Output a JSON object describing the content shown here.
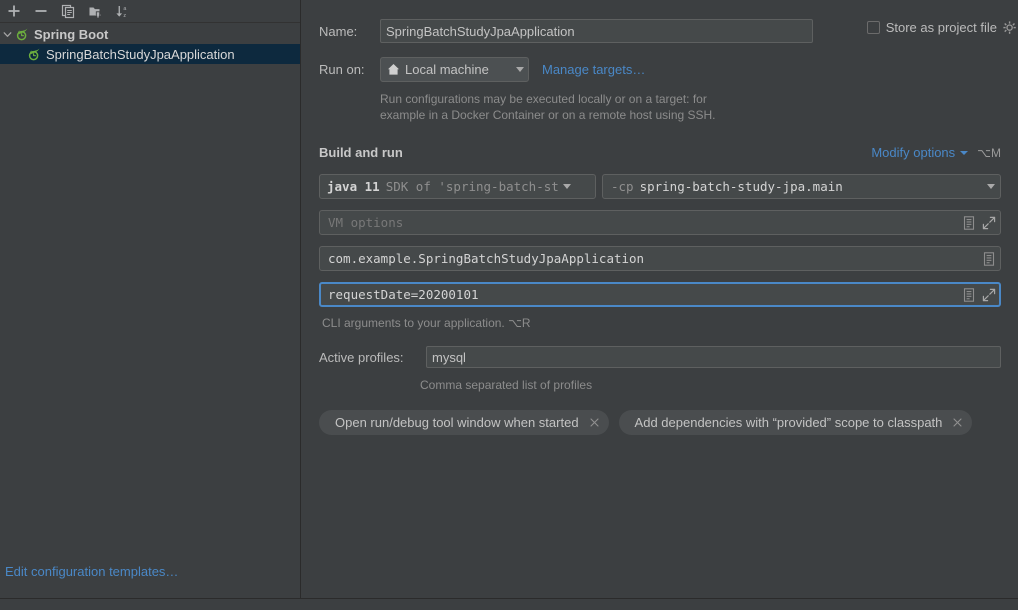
{
  "sidebar": {
    "toolbar": [
      {
        "name": "add-configuration-button",
        "icon": "plus-icon",
        "tooltip": "Add New Configuration"
      },
      {
        "name": "remove-configuration-button",
        "icon": "minus-icon",
        "tooltip": "Remove Configuration"
      },
      {
        "name": "copy-configuration-button",
        "icon": "copy-icon",
        "tooltip": "Copy Configuration"
      },
      {
        "name": "move-into-folder-button",
        "icon": "folder-add-icon",
        "tooltip": "Move into new folder"
      },
      {
        "name": "sort-configurations-button",
        "icon": "sort-az-icon",
        "tooltip": "Sort Configurations"
      }
    ],
    "tree": {
      "group": {
        "label": "Spring Boot",
        "expanded": true,
        "icon": "spring-boot-icon"
      },
      "items": [
        {
          "label": "SpringBatchStudyJpaApplication",
          "icon": "spring-boot-icon",
          "selected": true
        }
      ]
    },
    "edit_templates_link": "Edit configuration templates…"
  },
  "main": {
    "name": {
      "label": "Name:",
      "value": "SpringBatchStudyJpaApplication",
      "placeholder": ""
    },
    "store_as_project_file": {
      "label": "Store as project file",
      "checked": false,
      "gear_icon": "gear-icon"
    },
    "run_on": {
      "label": "Run on:",
      "selected": "Local machine",
      "icon": "home-icon",
      "manage_targets_link": "Manage targets…",
      "hint_line1": "Run configurations may be executed locally or on a target: for",
      "hint_line2": "example in a Docker Container or on a remote host using SSH."
    },
    "build_and_run": {
      "title": "Build and run",
      "modify_options_link": "Modify options",
      "modify_options_shortcut": "⌥M",
      "sdk": {
        "java": "java 11",
        "description": "SDK of 'spring-batch-st"
      },
      "classpath": {
        "flag": "-cp",
        "value": "spring-batch-study-jpa.main"
      },
      "vm_options": {
        "placeholder": "VM options",
        "value": "",
        "macro_icon": "macro-icon",
        "expand_icon": "expand-icon"
      },
      "main_class": {
        "value": "com.example.SpringBatchStudyJpaApplication",
        "macro_icon": "macro-icon"
      },
      "program_arguments": {
        "value": "requestDate=20200101",
        "focused": true,
        "macro_icon": "macro-icon",
        "expand_icon": "expand-icon"
      },
      "cli_hint": "CLI arguments to your application. ⌥R"
    },
    "active_profiles": {
      "label": "Active profiles:",
      "value": "mysql",
      "hint": "Comma separated list of profiles"
    },
    "option_chips": [
      {
        "label": "Open run/debug tool window when started",
        "close_icon": "close-icon"
      },
      {
        "label": "Add dependencies with “provided” scope to classpath",
        "close_icon": "close-icon"
      }
    ]
  },
  "colors": {
    "background": "#3c3f41",
    "field_background": "#45494a",
    "selection": "#0d293e",
    "link": "#4a88c7",
    "focus_border": "#4a88c7",
    "text": "#bbbbbb",
    "hint_text": "#8c8c8c",
    "spring_green": "#6cae3e"
  }
}
